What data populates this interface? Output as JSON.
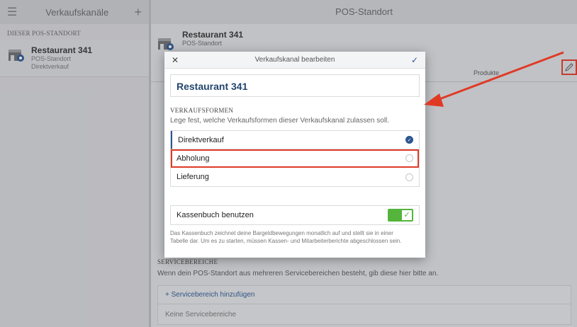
{
  "left_panel": {
    "title": "Verkaufskanäle",
    "section_label": "DIESER POS-STANDORT",
    "channel": {
      "name": "Restaurant 341",
      "type": "POS-Standort",
      "mode": "Direktverkauf"
    }
  },
  "right_panel": {
    "title": "POS-Standort",
    "store_name": "Restaurant 341",
    "store_type": "POS-Standort",
    "tab_products": "Produkte",
    "service_areas": {
      "title": "SERVICEBEREICHE",
      "description": "Wenn dein POS-Standort aus mehreren Servicebereichen besteht, gib diese hier bitte an.",
      "add_label": "+ Servicebereich hinzufügen",
      "empty_label": "Keine Servicebereiche"
    }
  },
  "dialog": {
    "title": "Verkaufskanal bearbeiten",
    "channel_name": "Restaurant 341",
    "section_title": "VERKAUFSFORMEN",
    "section_description": "Lege fest, welche Verkaufsformen dieser Verkaufskanal zulassen soll.",
    "options": [
      {
        "label": "Direktverkauf",
        "selected": true
      },
      {
        "label": "Abholung",
        "selected": false
      },
      {
        "label": "Lieferung",
        "selected": false
      }
    ],
    "cashbook": {
      "label": "Kassenbuch benutzen",
      "enabled": true,
      "description": "Das Kassenbuch zeichnet deine Bargeldbewegungen monatlich auf und stellt sie in einer Tabelle dar. Um es zu starten, müssen Kassen- und Mitarbeiterberichte abgeschlossen sein."
    }
  },
  "colors": {
    "accent": "#2b5791",
    "highlight": "#e03a25",
    "toggle_on": "#54b43c"
  },
  "icons": [
    "menu-icon",
    "plus-icon",
    "store-icon",
    "pencil-icon",
    "close-icon",
    "check-icon"
  ]
}
